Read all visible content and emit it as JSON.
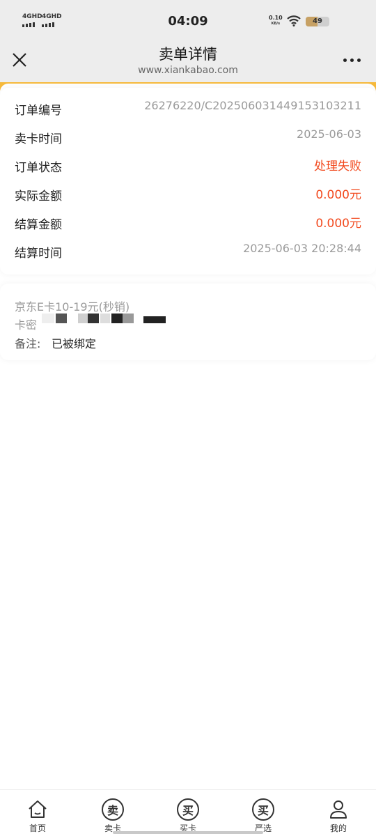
{
  "status_bar": {
    "signal1": "4GHD",
    "signal2": "4GHD",
    "time": "04:09",
    "net_speed": "0.10",
    "net_unit": "KB/s",
    "battery": "49",
    "battery_level": 0.49
  },
  "header": {
    "title": "卖单详情",
    "subtitle": "www.xiankabao.com"
  },
  "order": {
    "rows": [
      {
        "label": "订单编号",
        "value": "26276220/C20250603144915310321​1"
      },
      {
        "label": "卖卡时间",
        "value": "2025-06-03"
      },
      {
        "label": "订单状态",
        "value": "处理失败"
      },
      {
        "label": "实际金额",
        "value": "0.000元"
      },
      {
        "label": "结算金额",
        "value": "0.000元"
      },
      {
        "label": "结算时间",
        "value": "2025-06-03 20:28:44"
      }
    ]
  },
  "card_info": {
    "goods_name": "京东E卡10-19元(秒销)",
    "card_pwd_label": "卡密",
    "remark_label": "备注:",
    "remark_value": "已被绑定"
  },
  "tabbar": {
    "items": [
      {
        "label": "首页",
        "icon": "home-icon"
      },
      {
        "label": "卖卡",
        "icon": "sell-seal-icon",
        "glyph": "卖"
      },
      {
        "label": "买卡",
        "icon": "buy-seal-icon",
        "glyph": "买"
      },
      {
        "label": "严选",
        "icon": "select-seal-icon",
        "glyph": "买"
      },
      {
        "label": "我的",
        "icon": "profile-icon"
      }
    ]
  },
  "colors": {
    "accent": "#f6b93b",
    "status_red": "#f24a1f",
    "header_bg": "#ededed"
  }
}
